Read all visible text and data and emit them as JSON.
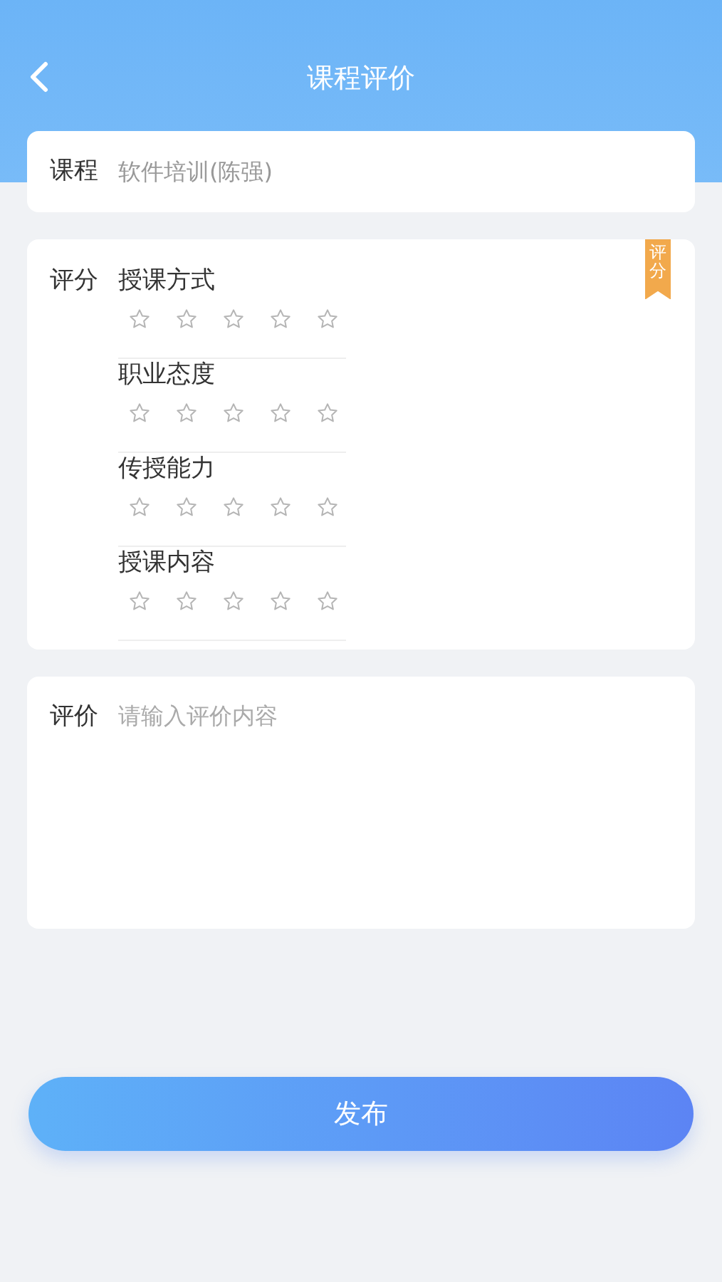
{
  "header": {
    "title": "课程评价"
  },
  "course": {
    "label": "课程",
    "value": "软件培训(陈强)"
  },
  "rating": {
    "label": "评分",
    "badge": "评分",
    "criteria": [
      {
        "name": "授课方式",
        "stars": 0
      },
      {
        "name": "职业态度",
        "stars": 0
      },
      {
        "name": "传授能力",
        "stars": 0
      },
      {
        "name": "授课内容",
        "stars": 0
      }
    ]
  },
  "review": {
    "label": "评价",
    "placeholder": "请输入评价内容"
  },
  "submit": {
    "label": "发布"
  }
}
